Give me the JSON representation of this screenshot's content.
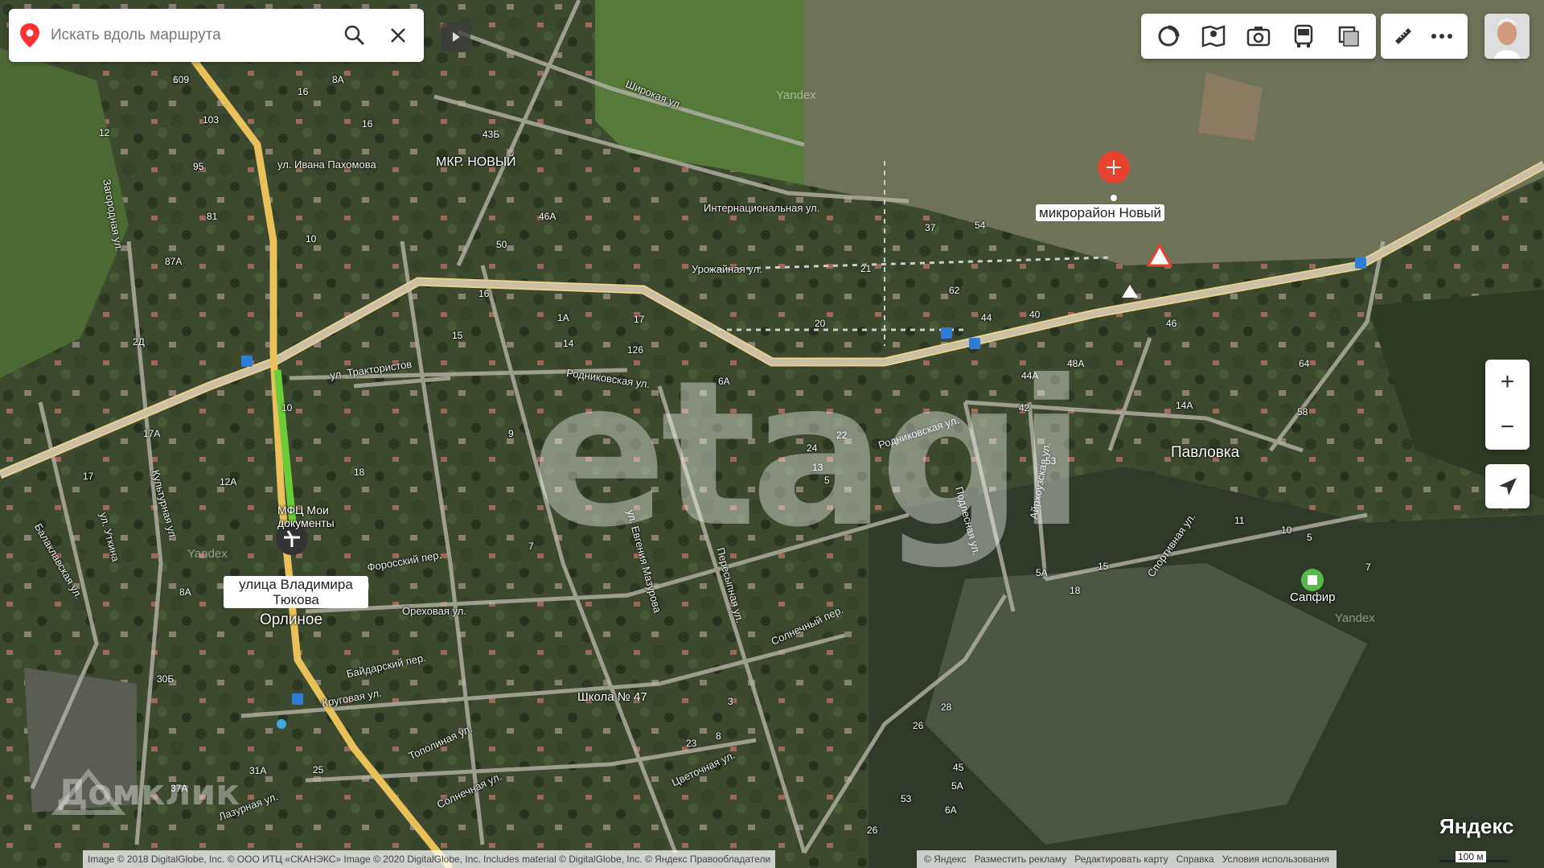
{
  "search": {
    "placeholder": "Искать вдоль маршрута"
  },
  "toolbar_icons": [
    "traffic-icon",
    "panorama-icon",
    "photo-icon",
    "transport-icon",
    "layers-icon",
    "ruler-icon",
    "more-icon"
  ],
  "selected_place": {
    "label": "микрорайон Новый"
  },
  "places": {
    "orlinoe": "Орлиное",
    "pavlovka": "Павловка",
    "mkr_novy": "МКР. НОВЫЙ",
    "tyukova": "улица Владимира Тюкова",
    "mfc": "МФЦ Мои документы",
    "school": "Школа № 47",
    "sapfir": "Сапфир"
  },
  "streets": {
    "ivana_pakhomova": "ул. Ивана Пахомова",
    "shirokaya": "Широкая ул.",
    "internatsionalnaya": "Интернациональная ул.",
    "urozhainaya": "Урожайная ул.",
    "traktoristov": "ул. Трактористов",
    "rodnikovskaya1": "Родниковская ул.",
    "rodnikovskaya2": "Родниковская ул.",
    "orekhovaya": "Ореховая ул.",
    "forosskiy": "Форосский пер.",
    "baidarskiy": "Байдарский пер.",
    "krugovaya": "Круговая ул.",
    "topolinaya": "Тополиная ул.",
    "solnechnaya": "Солнечная ул.",
    "tsvetochnaya": "Цветочная ул.",
    "solnechny_per": "Солнечный пер.",
    "sportivnaya": "Спортивная ул.",
    "podlesnaya": "Подлесная ул.",
    "ayrkhovaya": "Айрхоузская ул.",
    "yevgeniya_mazurova": "ул. Евгения Мазурова",
    "peresyp": "Пересыпная ул.",
    "zagorodnaya": "Загородная ул.",
    "kulturnaya": "Культурная ул.",
    "utkina": "ул. Уткина",
    "balaklavskaya": "Балаклавская ул.",
    "lazurnaya": "Лазурная ул."
  },
  "house_numbers": [
    "109",
    "103",
    "95",
    "81",
    "12",
    "16",
    "87А",
    "2Д",
    "17А",
    "17",
    "12А",
    "8А",
    "31А",
    "37А",
    "30Б",
    "25",
    "16",
    "8А",
    "10",
    "10",
    "18",
    "15",
    "43Б",
    "50",
    "46А",
    "16",
    "1А",
    "14",
    "126",
    "6А",
    "17",
    "20",
    "21",
    "37",
    "54",
    "62",
    "44",
    "40",
    "46",
    "14А",
    "58",
    "64",
    "48А",
    "44А",
    "42",
    "53",
    "22",
    "13",
    "5",
    "9",
    "7",
    "24",
    "3",
    "8",
    "23",
    "28",
    "26",
    "45",
    "26",
    "53",
    "5А",
    "6А",
    "5А",
    "18",
    "15",
    "11",
    "10",
    "5",
    "7",
    "6",
    "1"
  ],
  "watermarks": {
    "etagi": "etagi",
    "domclick": "Домклик",
    "yandex1": "Yandex",
    "yandex2": "Yandex",
    "yandex3": "Yandex"
  },
  "zoom": {
    "in": "+",
    "out": "−"
  },
  "footer": {
    "copyright": "Image © 2018 DigitalGlobe, Inc. © ООО ИТЦ «СКАНЭКС» Image © 2020 DigitalGlobe, Inc. Includes material © DigitalGlobe, Inc. © Яндекс  Правообладатели",
    "links": [
      "© Яндекс",
      "Разместить рекламу",
      "Редактировать карту",
      "Справка",
      "Условия использования"
    ],
    "scale": "100 м",
    "logo": "Яндекс"
  }
}
